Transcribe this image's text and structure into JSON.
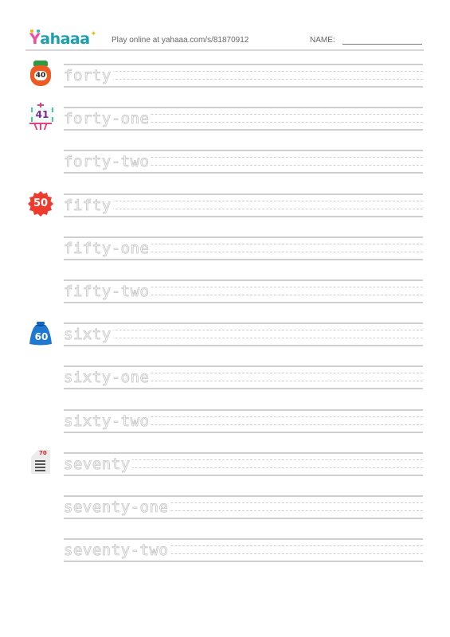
{
  "header": {
    "logo": {
      "first": "Y",
      "rest": "ahaaa",
      "spark": "✦"
    },
    "play_online": "Play online at yahaaa.com/s/81870912",
    "name_label": "NAME:"
  },
  "colors": {
    "logo_pink": "#ec4fa0",
    "logo_teal": "#1a9fb0",
    "trace_gray": "#c4c4c4",
    "line_gray": "#cfcfcf"
  },
  "rows": [
    {
      "word": "forty",
      "icon": {
        "name": "jar-icon",
        "number": "40"
      }
    },
    {
      "word": "forty-one",
      "icon": {
        "name": "easel-icon",
        "number": "41"
      }
    },
    {
      "word": "forty-two",
      "icon": null
    },
    {
      "word": "fifty",
      "icon": {
        "name": "badge-icon",
        "number": "50"
      }
    },
    {
      "word": "fifty-one",
      "icon": null
    },
    {
      "word": "fifty-two",
      "icon": null
    },
    {
      "word": "sixty",
      "icon": {
        "name": "helmet-icon",
        "number": "60"
      }
    },
    {
      "word": "sixty-one",
      "icon": null
    },
    {
      "word": "sixty-two",
      "icon": null
    },
    {
      "word": "seventy",
      "icon": {
        "name": "document-icon",
        "number": "70"
      }
    },
    {
      "word": "seventy-one",
      "icon": null
    },
    {
      "word": "seventy-two",
      "icon": null
    }
  ]
}
